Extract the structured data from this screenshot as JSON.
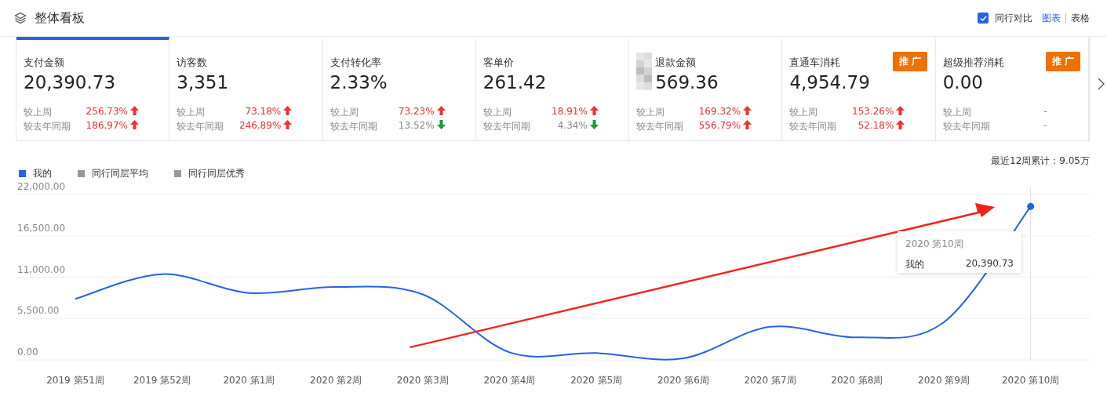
{
  "header": {
    "title": "整体看板",
    "compare": {
      "label": "同行对比",
      "checked": true
    },
    "views": [
      {
        "label": "图表",
        "selected": true
      },
      {
        "label": "表格",
        "selected": false
      }
    ]
  },
  "cards": [
    {
      "title": "支付金额",
      "value": "20,390.73",
      "selected": true,
      "rows": [
        {
          "label": "较上周",
          "value": "256.73%",
          "kind": "up"
        },
        {
          "label": "较去年同期",
          "value": "186.97%",
          "kind": "up"
        }
      ]
    },
    {
      "title": "访客数",
      "value": "3,351",
      "selected": false,
      "rows": [
        {
          "label": "较上周",
          "value": "73.18%",
          "kind": "up"
        },
        {
          "label": "较去年同期",
          "value": "246.89%",
          "kind": "up"
        }
      ]
    },
    {
      "title": "支付转化率",
      "value": "2.33%",
      "selected": false,
      "rows": [
        {
          "label": "较上周",
          "value": "73.23%",
          "kind": "up"
        },
        {
          "label": "较去年同期",
          "value": "13.52%",
          "kind": "down"
        }
      ]
    },
    {
      "title": "客单价",
      "value": "261.42",
      "selected": false,
      "rows": [
        {
          "label": "较上周",
          "value": "18.91%",
          "kind": "up"
        },
        {
          "label": "较去年同期",
          "value": "4.34%",
          "kind": "down"
        }
      ]
    },
    {
      "title": "退款金额",
      "value": "569.36",
      "selected": false,
      "masked": true,
      "rows": [
        {
          "label": "较上周",
          "value": "169.32%",
          "kind": "up"
        },
        {
          "label": "较去年同期",
          "value": "556.79%",
          "kind": "up"
        }
      ]
    },
    {
      "title": "直通车消耗",
      "value": "4,954.79",
      "badge": "推 广",
      "selected": false,
      "rows": [
        {
          "label": "较上周",
          "value": "153.26%",
          "kind": "up"
        },
        {
          "label": "较去年同期",
          "value": "52.18%",
          "kind": "up"
        }
      ]
    },
    {
      "title": "超级推荐消耗",
      "value": "0.00",
      "badge": "推 广",
      "selected": false,
      "rows": [
        {
          "label": "较上周",
          "value": "-",
          "kind": "none"
        },
        {
          "label": "较去年同期",
          "value": "-",
          "kind": "none"
        }
      ]
    }
  ],
  "summary": "最近12周累计：9.05万",
  "chart_data": {
    "type": "line",
    "categories": [
      "2019 第51周",
      "2019 第52周",
      "2020 第1周",
      "2020 第2周",
      "2020 第3周",
      "2020 第4周",
      "2020 第5周",
      "2020 第6周",
      "2020 第7周",
      "2020 第8周",
      "2020 第9周",
      "2020 第10周"
    ],
    "series": [
      {
        "name": "我的",
        "color": "#2463e6",
        "values": [
          8100,
          11400,
          8900,
          9700,
          8700,
          1000,
          900,
          200,
          4400,
          3000,
          5000,
          20400
        ]
      },
      {
        "name": "同行同层平均",
        "color": "#999999",
        "values": [
          null,
          null,
          null,
          null,
          null,
          null,
          null,
          null,
          null,
          null,
          null,
          null
        ]
      },
      {
        "name": "同行同层优秀",
        "color": "#999999",
        "values": [
          null,
          null,
          null,
          null,
          null,
          null,
          null,
          null,
          null,
          null,
          null,
          null
        ]
      }
    ],
    "grid": true,
    "ylim": [
      0,
      22000
    ],
    "yticks": [
      {
        "value": 0,
        "label": "0.00"
      },
      {
        "value": 5500,
        "label": "5,500.00"
      },
      {
        "value": 11000,
        "label": "11,000.00"
      },
      {
        "value": 16500,
        "label": "16,500.00"
      },
      {
        "value": 22000,
        "label": "22,000.00"
      }
    ]
  },
  "tooltip": {
    "title": "2020 第10周",
    "label": "我的",
    "value": "20,390.73"
  }
}
